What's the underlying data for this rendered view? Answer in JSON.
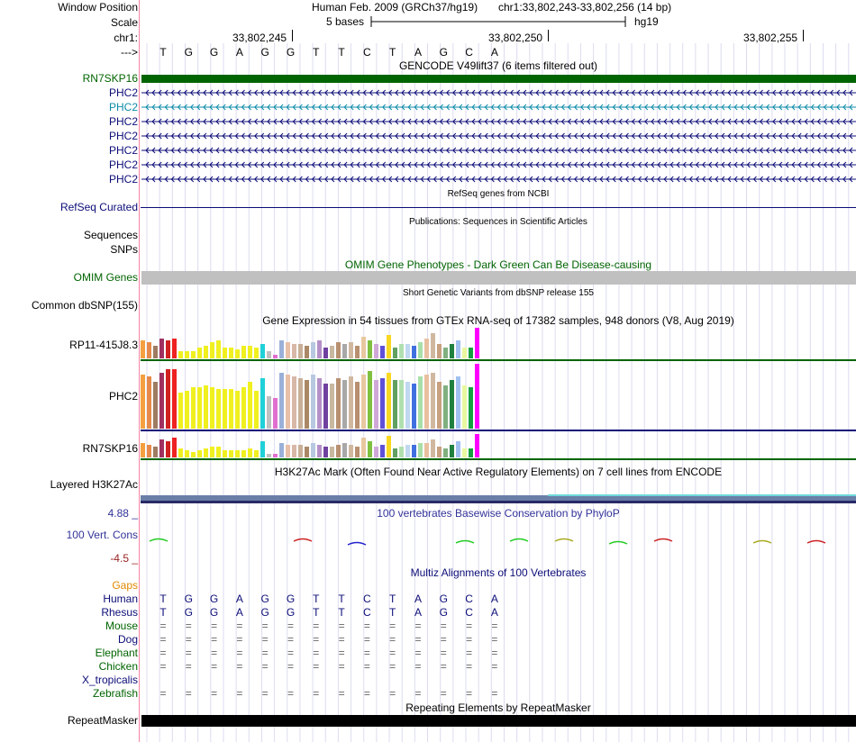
{
  "header": {
    "window_position_label": "Window Position",
    "assembly": "Human Feb. 2009 (GRCh37/hg19)",
    "position": "chr1:33,802,243-33,802,256 (14 bp)",
    "scale_label": "Scale",
    "scale_bases": "5 bases",
    "scale_db": "hg19",
    "chrom_label": "chr1:",
    "arrow_label": "--->",
    "coords": [
      "33,802,245",
      "33,802,250",
      "33,802,255"
    ],
    "bases": [
      "T",
      "G",
      "G",
      "A",
      "G",
      "G",
      "T",
      "T",
      "C",
      "T",
      "A",
      "G",
      "C",
      "A"
    ]
  },
  "gencode": {
    "title": "GENCODE V49lift37 (6 items filtered out)",
    "genes": [
      {
        "label": "RN7SKP16",
        "color": "#006400"
      },
      {
        "label": "PHC2",
        "color": "#0c0c78"
      },
      {
        "label": "PHC2",
        "color": "#0d8ba8"
      },
      {
        "label": "PHC2",
        "color": "#0c0c78"
      },
      {
        "label": "PHC2",
        "color": "#0c0c78"
      },
      {
        "label": "PHC2",
        "color": "#0c0c78"
      },
      {
        "label": "PHC2",
        "color": "#0c0c78"
      },
      {
        "label": "PHC2",
        "color": "#0c0c78"
      }
    ]
  },
  "refseq": {
    "title": "RefSeq genes from NCBI",
    "label": "RefSeq Curated"
  },
  "publications": {
    "title": "Publications: Sequences in Scientific Articles",
    "label1": "Sequences",
    "label2": "SNPs"
  },
  "omim": {
    "title": "OMIM Gene Phenotypes - Dark Green Can Be Disease-causing",
    "label": "OMIM Genes"
  },
  "dbsnp": {
    "title": "Short Genetic Variants from dbSNP release 155",
    "label": "Common dbSNP(155)"
  },
  "gtex": {
    "title": "Gene Expression in 54 tissues from GTEx RNA-seq of 17382 samples, 948 donors (V8, Aug 2019)",
    "rows": [
      "RP11-415J8.3",
      "PHC2",
      "RN7SKP16"
    ]
  },
  "h3k27ac": {
    "title": "H3K27Ac Mark (Often Found Near Active Regulatory Elements) on 7 cell lines from ENCODE",
    "label": "Layered H3K27Ac"
  },
  "phylop": {
    "title": "100 vertebrates Basewise Conservation by PhyloP",
    "label": "100 Vert. Cons",
    "max": "4.88 _",
    "min": "-4.5 _"
  },
  "multiz": {
    "title": "Multiz Alignments of 100 Vertebrates",
    "species": [
      {
        "name": "Gaps",
        "color": "#e08a00",
        "row": ""
      },
      {
        "name": "Human",
        "color": "#0c0c78",
        "row": "TGGAGGTTCTAGCA"
      },
      {
        "name": "Rhesus",
        "color": "#0c0c78",
        "row": "TGGAGGTTCTAGCA"
      },
      {
        "name": "Mouse",
        "color": "#006400",
        "row": "=============="
      },
      {
        "name": "Dog",
        "color": "#0c0c78",
        "row": "=============="
      },
      {
        "name": "Elephant",
        "color": "#006400",
        "row": "=============="
      },
      {
        "name": "Chicken",
        "color": "#006400",
        "row": "=============="
      },
      {
        "name": "X_tropicalis",
        "color": "#0c0c78",
        "row": ""
      },
      {
        "name": "Zebrafish",
        "color": "#006400",
        "row": "=============="
      }
    ]
  },
  "repeatmasker": {
    "title": "Repeating Elements by RepeatMasker",
    "label": "RepeatMasker"
  }
}
